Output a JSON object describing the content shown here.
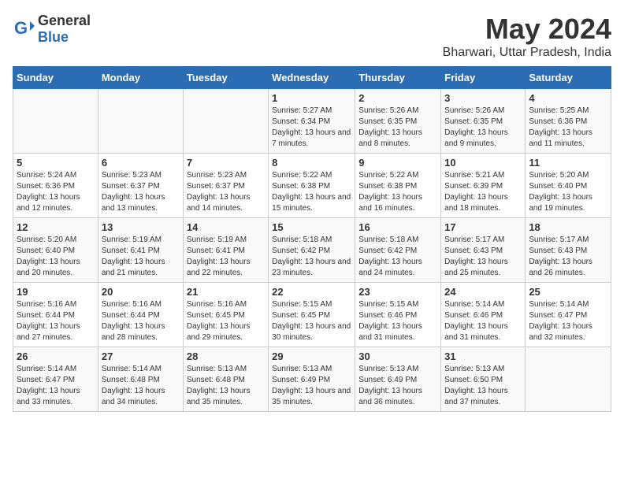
{
  "header": {
    "title": "May 2024",
    "subtitle": "Bharwari, Uttar Pradesh, India",
    "logo_general": "General",
    "logo_blue": "Blue"
  },
  "days_of_week": [
    "Sunday",
    "Monday",
    "Tuesday",
    "Wednesday",
    "Thursday",
    "Friday",
    "Saturday"
  ],
  "weeks": [
    [
      {
        "day": "",
        "info": ""
      },
      {
        "day": "",
        "info": ""
      },
      {
        "day": "",
        "info": ""
      },
      {
        "day": "1",
        "info": "Sunrise: 5:27 AM\nSunset: 6:34 PM\nDaylight: 13 hours and 7 minutes."
      },
      {
        "day": "2",
        "info": "Sunrise: 5:26 AM\nSunset: 6:35 PM\nDaylight: 13 hours and 8 minutes."
      },
      {
        "day": "3",
        "info": "Sunrise: 5:26 AM\nSunset: 6:35 PM\nDaylight: 13 hours and 9 minutes."
      },
      {
        "day": "4",
        "info": "Sunrise: 5:25 AM\nSunset: 6:36 PM\nDaylight: 13 hours and 11 minutes."
      }
    ],
    [
      {
        "day": "5",
        "info": "Sunrise: 5:24 AM\nSunset: 6:36 PM\nDaylight: 13 hours and 12 minutes."
      },
      {
        "day": "6",
        "info": "Sunrise: 5:23 AM\nSunset: 6:37 PM\nDaylight: 13 hours and 13 minutes."
      },
      {
        "day": "7",
        "info": "Sunrise: 5:23 AM\nSunset: 6:37 PM\nDaylight: 13 hours and 14 minutes."
      },
      {
        "day": "8",
        "info": "Sunrise: 5:22 AM\nSunset: 6:38 PM\nDaylight: 13 hours and 15 minutes."
      },
      {
        "day": "9",
        "info": "Sunrise: 5:22 AM\nSunset: 6:38 PM\nDaylight: 13 hours and 16 minutes."
      },
      {
        "day": "10",
        "info": "Sunrise: 5:21 AM\nSunset: 6:39 PM\nDaylight: 13 hours and 18 minutes."
      },
      {
        "day": "11",
        "info": "Sunrise: 5:20 AM\nSunset: 6:40 PM\nDaylight: 13 hours and 19 minutes."
      }
    ],
    [
      {
        "day": "12",
        "info": "Sunrise: 5:20 AM\nSunset: 6:40 PM\nDaylight: 13 hours and 20 minutes."
      },
      {
        "day": "13",
        "info": "Sunrise: 5:19 AM\nSunset: 6:41 PM\nDaylight: 13 hours and 21 minutes."
      },
      {
        "day": "14",
        "info": "Sunrise: 5:19 AM\nSunset: 6:41 PM\nDaylight: 13 hours and 22 minutes."
      },
      {
        "day": "15",
        "info": "Sunrise: 5:18 AM\nSunset: 6:42 PM\nDaylight: 13 hours and 23 minutes."
      },
      {
        "day": "16",
        "info": "Sunrise: 5:18 AM\nSunset: 6:42 PM\nDaylight: 13 hours and 24 minutes."
      },
      {
        "day": "17",
        "info": "Sunrise: 5:17 AM\nSunset: 6:43 PM\nDaylight: 13 hours and 25 minutes."
      },
      {
        "day": "18",
        "info": "Sunrise: 5:17 AM\nSunset: 6:43 PM\nDaylight: 13 hours and 26 minutes."
      }
    ],
    [
      {
        "day": "19",
        "info": "Sunrise: 5:16 AM\nSunset: 6:44 PM\nDaylight: 13 hours and 27 minutes."
      },
      {
        "day": "20",
        "info": "Sunrise: 5:16 AM\nSunset: 6:44 PM\nDaylight: 13 hours and 28 minutes."
      },
      {
        "day": "21",
        "info": "Sunrise: 5:16 AM\nSunset: 6:45 PM\nDaylight: 13 hours and 29 minutes."
      },
      {
        "day": "22",
        "info": "Sunrise: 5:15 AM\nSunset: 6:45 PM\nDaylight: 13 hours and 30 minutes."
      },
      {
        "day": "23",
        "info": "Sunrise: 5:15 AM\nSunset: 6:46 PM\nDaylight: 13 hours and 31 minutes."
      },
      {
        "day": "24",
        "info": "Sunrise: 5:14 AM\nSunset: 6:46 PM\nDaylight: 13 hours and 31 minutes."
      },
      {
        "day": "25",
        "info": "Sunrise: 5:14 AM\nSunset: 6:47 PM\nDaylight: 13 hours and 32 minutes."
      }
    ],
    [
      {
        "day": "26",
        "info": "Sunrise: 5:14 AM\nSunset: 6:47 PM\nDaylight: 13 hours and 33 minutes."
      },
      {
        "day": "27",
        "info": "Sunrise: 5:14 AM\nSunset: 6:48 PM\nDaylight: 13 hours and 34 minutes."
      },
      {
        "day": "28",
        "info": "Sunrise: 5:13 AM\nSunset: 6:48 PM\nDaylight: 13 hours and 35 minutes."
      },
      {
        "day": "29",
        "info": "Sunrise: 5:13 AM\nSunset: 6:49 PM\nDaylight: 13 hours and 35 minutes."
      },
      {
        "day": "30",
        "info": "Sunrise: 5:13 AM\nSunset: 6:49 PM\nDaylight: 13 hours and 36 minutes."
      },
      {
        "day": "31",
        "info": "Sunrise: 5:13 AM\nSunset: 6:50 PM\nDaylight: 13 hours and 37 minutes."
      },
      {
        "day": "",
        "info": ""
      }
    ]
  ]
}
